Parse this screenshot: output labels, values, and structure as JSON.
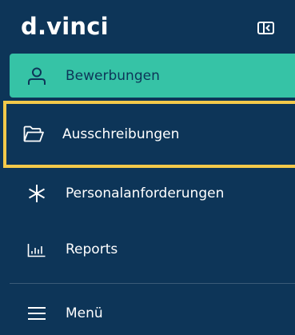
{
  "brand": {
    "logo_text": "d.vinci"
  },
  "nav": {
    "items": [
      {
        "label": "Bewerbungen",
        "icon": "user-icon",
        "active": true
      },
      {
        "label": "Ausschreibungen",
        "icon": "folder-open-icon",
        "highlighted": true
      },
      {
        "label": "Personalanforderungen",
        "icon": "asterisk-icon"
      },
      {
        "label": "Reports",
        "icon": "bar-chart-icon"
      }
    ],
    "menu_label": "Menü"
  },
  "colors": {
    "sidebar_bg": "#0d3558",
    "active_bg": "#36c3a6",
    "highlight_border": "#f3c94a",
    "text": "#ffffff"
  }
}
